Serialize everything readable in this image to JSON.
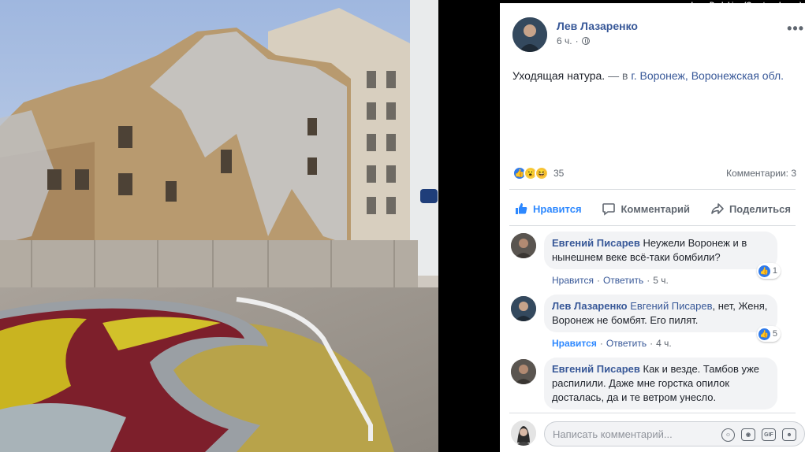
{
  "credit": "Lena Dudukina (Courtesy Image)",
  "post": {
    "author": "Лев Лазаренко",
    "time": "6 ч.",
    "text_main": "Уходящая натура.",
    "text_sep": " — в ",
    "text_place": "г. Воронеж, Воронежская обл.",
    "reaction_count": "35",
    "comments_count": "Комментарии: 3"
  },
  "actions": {
    "like": "Нравится",
    "comment": "Комментарий",
    "share": "Поделиться"
  },
  "comments": [
    {
      "author": "Евгений Писарев",
      "mention": "",
      "text": "Неужели Воронеж и в нынешнем веке всё-таки бомбили?",
      "like_label": "Нравится",
      "reply_label": "Ответить",
      "time": "5 ч.",
      "reactions": "1"
    },
    {
      "author": "Лев Лазаренко",
      "mention": "Евгений Писарев",
      "text": ", нет, Женя, Воронеж не бомбят. Его пилят.",
      "like_label": "Нравится",
      "reply_label": "Ответить",
      "time": "4 ч.",
      "reactions": "5"
    },
    {
      "author": "Евгений Писарев",
      "mention": "",
      "text": "Как и везде. Тамбов уже распилили. Даже мне горстка опилок досталась, да и те ветром унесло.",
      "like_label": "",
      "reply_label": "",
      "time": "",
      "reactions": ""
    }
  ],
  "composer": {
    "placeholder": "Написать комментарий..."
  },
  "colors": {
    "link": "#385898",
    "like_active": "#2d88ff",
    "muted": "#606770"
  },
  "icons": [
    "more-icon",
    "globe-icon",
    "like-icon",
    "comment-icon",
    "share-icon",
    "emoji-icon",
    "camera-icon",
    "gif-icon",
    "sticker-icon"
  ]
}
